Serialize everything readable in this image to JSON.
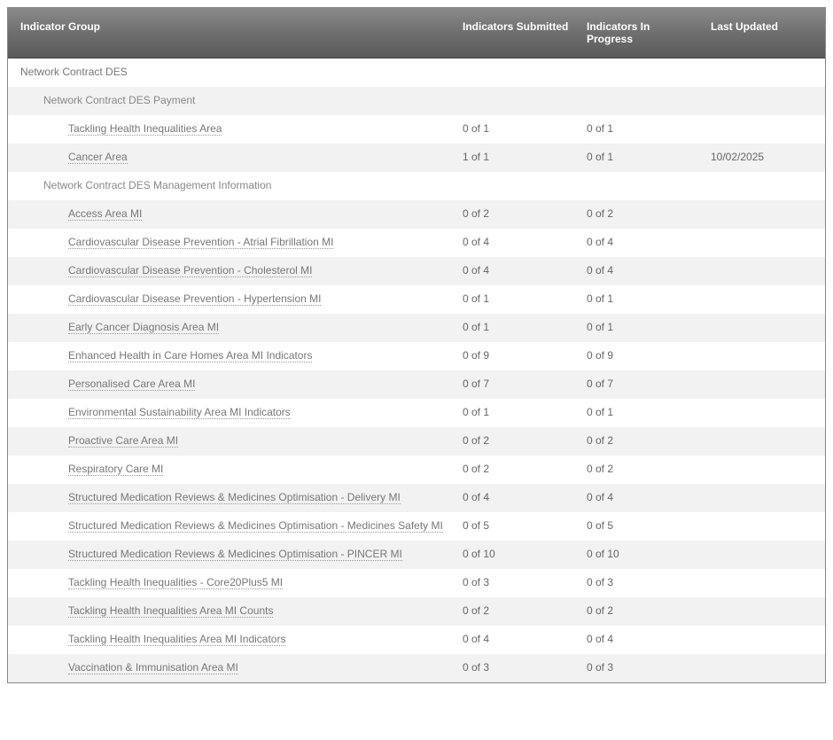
{
  "headers": {
    "group": "Indicator Group",
    "submitted": "Indicators Submitted",
    "progress": "Indicators In Progress",
    "updated": "Last Updated"
  },
  "rows": [
    {
      "level": 0,
      "alt": false,
      "label": "Network Contract DES",
      "submitted": "",
      "progress": "",
      "updated": ""
    },
    {
      "level": 1,
      "alt": true,
      "label": "Network Contract DES Payment",
      "submitted": "",
      "progress": "",
      "updated": ""
    },
    {
      "level": 2,
      "alt": false,
      "label": "Tackling Health Inequalities Area",
      "submitted": "0 of 1",
      "progress": "0 of 1",
      "updated": ""
    },
    {
      "level": 2,
      "alt": true,
      "label": "Cancer Area",
      "submitted": "1 of 1",
      "progress": "0 of 1",
      "updated": "10/02/2025"
    },
    {
      "level": 1,
      "alt": false,
      "label": "Network Contract DES Management Information",
      "submitted": "",
      "progress": "",
      "updated": ""
    },
    {
      "level": 2,
      "alt": true,
      "label": "Access Area MI",
      "submitted": "0 of 2",
      "progress": "0 of 2",
      "updated": ""
    },
    {
      "level": 2,
      "alt": false,
      "label": "Cardiovascular Disease Prevention - Atrial Fibrillation MI",
      "submitted": "0 of 4",
      "progress": "0 of 4",
      "updated": ""
    },
    {
      "level": 2,
      "alt": true,
      "label": "Cardiovascular Disease Prevention - Cholesterol MI",
      "submitted": "0 of 4",
      "progress": "0 of 4",
      "updated": ""
    },
    {
      "level": 2,
      "alt": false,
      "label": "Cardiovascular Disease Prevention - Hypertension MI",
      "submitted": "0 of 1",
      "progress": "0 of 1",
      "updated": ""
    },
    {
      "level": 2,
      "alt": true,
      "label": "Early Cancer Diagnosis Area MI",
      "submitted": "0 of 1",
      "progress": "0 of 1",
      "updated": ""
    },
    {
      "level": 2,
      "alt": false,
      "label": "Enhanced Health in Care Homes Area MI Indicators",
      "submitted": "0 of 9",
      "progress": "0 of 9",
      "updated": ""
    },
    {
      "level": 2,
      "alt": true,
      "label": "Personalised Care Area MI",
      "submitted": "0 of 7",
      "progress": "0 of 7",
      "updated": ""
    },
    {
      "level": 2,
      "alt": false,
      "label": "Environmental Sustainability Area MI Indicators",
      "submitted": "0 of 1",
      "progress": "0 of 1",
      "updated": ""
    },
    {
      "level": 2,
      "alt": true,
      "label": "Proactive Care Area MI",
      "submitted": "0 of 2",
      "progress": "0 of 2",
      "updated": ""
    },
    {
      "level": 2,
      "alt": false,
      "label": "Respiratory Care MI",
      "submitted": "0 of 2",
      "progress": "0 of 2",
      "updated": ""
    },
    {
      "level": 2,
      "alt": true,
      "label": "Structured Medication Reviews & Medicines Optimisation - Delivery MI",
      "submitted": "0 of 4",
      "progress": "0 of 4",
      "updated": ""
    },
    {
      "level": 2,
      "alt": false,
      "label": "Structured Medication Reviews & Medicines Optimisation - Medicines Safety MI",
      "submitted": "0 of 5",
      "progress": "0 of 5",
      "updated": ""
    },
    {
      "level": 2,
      "alt": true,
      "label": "Structured Medication Reviews & Medicines Optimisation - PINCER MI",
      "submitted": "0 of 10",
      "progress": "0 of 10",
      "updated": ""
    },
    {
      "level": 2,
      "alt": false,
      "label": "Tackling Health Inequalities - Core20Plus5 MI",
      "submitted": "0 of 3",
      "progress": "0 of 3",
      "updated": ""
    },
    {
      "level": 2,
      "alt": true,
      "label": "Tackling Health Inequalities Area MI Counts",
      "submitted": "0 of 2",
      "progress": "0 of 2",
      "updated": ""
    },
    {
      "level": 2,
      "alt": false,
      "label": "Tackling Health Inequalities Area MI Indicators",
      "submitted": "0 of 4",
      "progress": "0 of 4",
      "updated": ""
    },
    {
      "level": 2,
      "alt": true,
      "label": "Vaccination & Immunisation Area MI",
      "submitted": "0 of 3",
      "progress": "0 of 3",
      "updated": ""
    }
  ]
}
